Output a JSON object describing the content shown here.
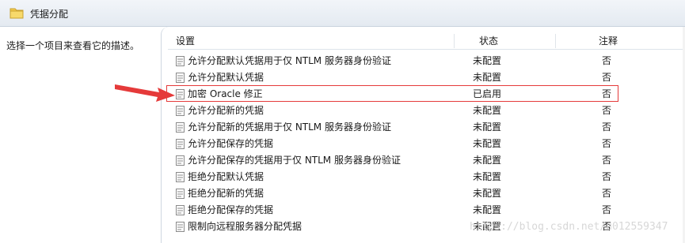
{
  "window": {
    "title": "凭据分配"
  },
  "left_pane": {
    "description": "选择一个项目来查看它的描述。"
  },
  "table": {
    "columns": {
      "setting": "设置",
      "state": "状态",
      "note": "注释"
    },
    "rows": [
      {
        "name": "允许分配默认凭据用于仅 NTLM 服务器身份验证",
        "state": "未配置",
        "note": "否"
      },
      {
        "name": "允许分配默认凭据",
        "state": "未配置",
        "note": "否"
      },
      {
        "name": "加密 Oracle 修正",
        "state": "已启用",
        "note": "否"
      },
      {
        "name": "允许分配新的凭据",
        "state": "未配置",
        "note": "否"
      },
      {
        "name": "允许分配新的凭据用于仅 NTLM 服务器身份验证",
        "state": "未配置",
        "note": "否"
      },
      {
        "name": "允许分配保存的凭据",
        "state": "未配置",
        "note": "否"
      },
      {
        "name": "允许分配保存的凭据用于仅 NTLM 服务器身份验证",
        "state": "未配置",
        "note": "否"
      },
      {
        "name": "拒绝分配默认凭据",
        "state": "未配置",
        "note": "否"
      },
      {
        "name": "拒绝分配新的凭据",
        "state": "未配置",
        "note": "否"
      },
      {
        "name": "拒绝分配保存的凭据",
        "state": "未配置",
        "note": "否"
      },
      {
        "name": "限制向远程服务器分配凭据",
        "state": "未配置",
        "note": "否"
      }
    ]
  },
  "annotation": {
    "highlight_color": "#e53a3a",
    "highlighted_row": "加密 Oracle 修正"
  },
  "icons": {
    "title": "folder-icon",
    "row": "policy-setting-icon",
    "annotation": "red-arrow-icon"
  },
  "watermark": "https://blog.csdn.net/u012559347"
}
